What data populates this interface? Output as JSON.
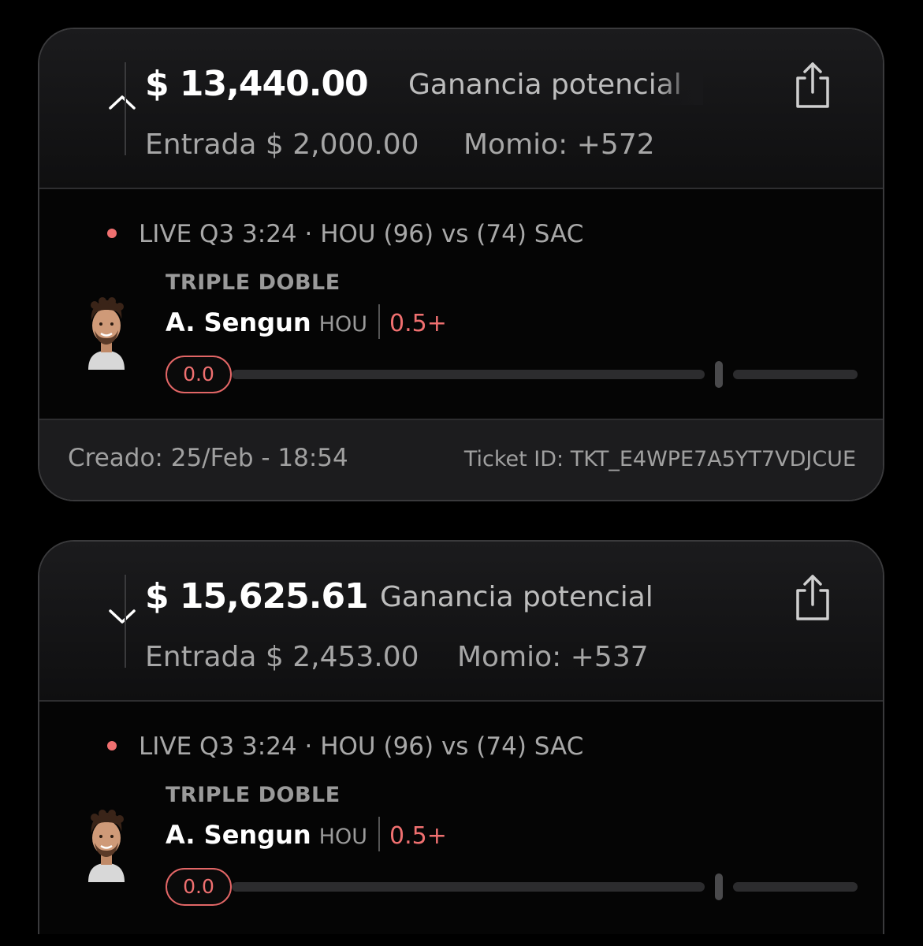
{
  "tickets": [
    {
      "expanded": true,
      "chevron_icon": "chevron-up-icon",
      "amount": "$ 13,440.00",
      "gain_label": "Ganancia potencial",
      "entry": "Entrada $ 2,000.00",
      "odds": "Momio: +572",
      "share_icon": "share-icon",
      "live": "LIVE Q3 3:24 · HOU (96) vs (74) SAC",
      "market": "TRIPLE DOBLE",
      "player": "A. Sengun",
      "team": "HOU",
      "line": "0.5+",
      "progress_value": "0.0",
      "progress_fraction": 0.0,
      "created": "Creado: 25/Feb - 18:54",
      "ticket_id": "Ticket ID: TKT_E4WPE7A5YT7VDJCUE"
    },
    {
      "expanded": false,
      "chevron_icon": "chevron-down-icon",
      "amount": "$ 15,625.61",
      "gain_label": "Ganancia potencial",
      "entry": "Entrada $ 2,453.00",
      "odds": "Momio: +537",
      "share_icon": "share-icon",
      "live": "LIVE Q3 3:24 · HOU (96) vs (74) SAC",
      "market": "TRIPLE DOBLE",
      "player": "A. Sengun",
      "team": "HOU",
      "line": "0.5+",
      "progress_value": "0.0",
      "progress_fraction": 0.0
    }
  ],
  "colors": {
    "accent": "#f07070",
    "background": "#000000",
    "card_header": "#1b1b1d",
    "footer": "#1c1c1e"
  }
}
